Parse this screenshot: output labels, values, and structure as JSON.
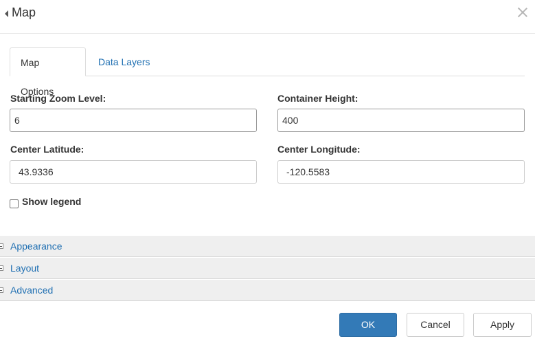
{
  "dialog": {
    "title": "Map"
  },
  "tabs": [
    {
      "label": "Map Options",
      "active": true
    },
    {
      "label": "Data Layers",
      "active": false
    }
  ],
  "fields": {
    "zoom": {
      "label": "Starting Zoom Level:",
      "value": "6"
    },
    "height": {
      "label": "Container Height:",
      "value": "400"
    },
    "latitude": {
      "label": "Center Latitude:",
      "value": "43.9336"
    },
    "longitude": {
      "label": "Center Longitude:",
      "value": "-120.5583"
    }
  },
  "legend": {
    "label": "Show legend",
    "checked": false
  },
  "sections": [
    {
      "label": "Appearance"
    },
    {
      "label": "Layout"
    },
    {
      "label": "Advanced"
    }
  ],
  "buttons": {
    "ok": "OK",
    "cancel": "Cancel",
    "apply": "Apply"
  },
  "colors": {
    "primary": "#337ab7",
    "link": "#1f6fb2",
    "section_bg": "#efefef"
  }
}
